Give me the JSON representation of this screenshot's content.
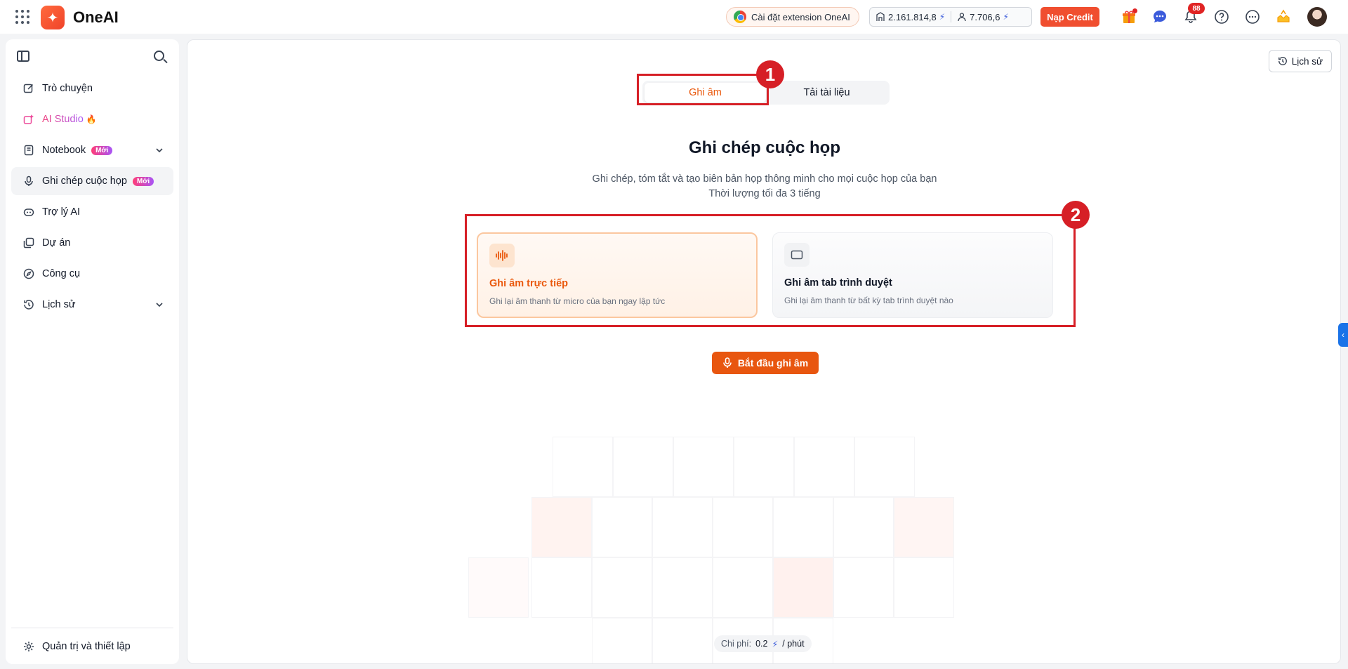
{
  "app": {
    "brand": "OneAI"
  },
  "topbar": {
    "extension_label": "Cài đặt extension OneAI",
    "stat_1": "2.161.814,8",
    "stat_2": "7.706,6",
    "credit_label": "Nạp Credit",
    "notification_count": "88"
  },
  "sidebar": {
    "items": [
      {
        "label": "Trò chuyện"
      },
      {
        "label": "AI Studio"
      },
      {
        "label": "Notebook",
        "badge": "Mới"
      },
      {
        "label": "Ghi chép cuộc họp",
        "badge": "Mới"
      },
      {
        "label": "Trợ lý AI"
      },
      {
        "label": "Dự án"
      },
      {
        "label": "Công cụ"
      },
      {
        "label": "Lịch sử"
      }
    ],
    "settings_label": "Quản trị và thiết lập"
  },
  "main": {
    "history_label": "Lịch sử",
    "tabs": [
      {
        "label": "Ghi âm"
      },
      {
        "label": "Tải tài liệu"
      }
    ],
    "title": "Ghi chép cuộc họp",
    "description_line1": "Ghi chép, tóm tắt và tạo biên bản họp thông minh cho mọi cuộc họp của bạn",
    "description_line2": "Thời lượng tối đa 3 tiếng",
    "cards": [
      {
        "title": "Ghi âm trực tiếp",
        "desc": "Ghi lại âm thanh từ micro của bạn ngay lập tức"
      },
      {
        "title": "Ghi âm tab trình duyệt",
        "desc": "Ghi lại âm thanh từ bất kỳ tab trình duyệt nào"
      }
    ],
    "start_label": "Bắt đầu ghi âm",
    "fee_label": "Chi phí:",
    "fee_amount": "0.2",
    "fee_unit": "/ phút"
  },
  "annotations": {
    "marker_1": "1",
    "marker_2": "2"
  },
  "colors": {
    "accent": "#ea580c",
    "brand": "#f0432a",
    "annotation": "#d61f26"
  }
}
